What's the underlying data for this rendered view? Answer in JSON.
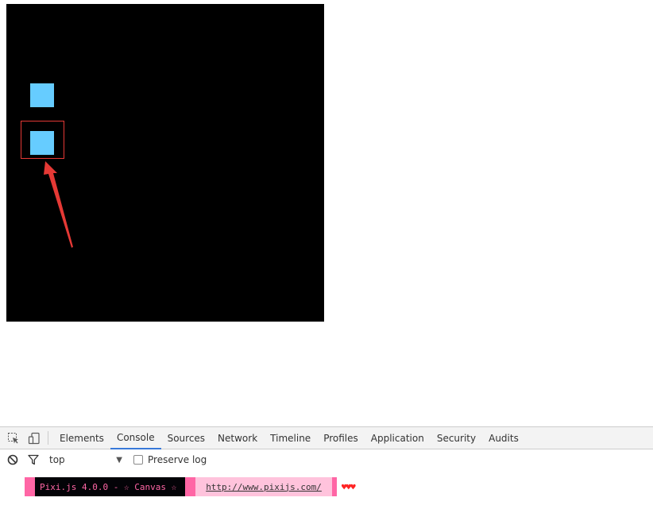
{
  "canvas": {
    "background": "#000000",
    "sprite_color": "#66ccff",
    "annotation_color": "#e53935"
  },
  "devtools": {
    "tools": [
      {
        "icon": "inspect-element-icon"
      },
      {
        "icon": "device-toolbar-icon"
      }
    ],
    "tabs": [
      {
        "label": "Elements",
        "active": false
      },
      {
        "label": "Console",
        "active": true
      },
      {
        "label": "Sources",
        "active": false
      },
      {
        "label": "Network",
        "active": false
      },
      {
        "label": "Timeline",
        "active": false
      },
      {
        "label": "Profiles",
        "active": false
      },
      {
        "label": "Application",
        "active": false
      },
      {
        "label": "Security",
        "active": false
      },
      {
        "label": "Audits",
        "active": false
      }
    ],
    "toolbar": {
      "clear_icon": "clear-console-icon",
      "filter_icon": "filter-icon",
      "context": "top",
      "context_arrow": "▼",
      "preserve_log_label": "Preserve log",
      "preserve_log_checked": false
    },
    "console": {
      "log_badge": "Pixi.js 4.0.0 - ☆ Canvas ☆",
      "log_link": "http://www.pixijs.com/",
      "log_hearts": "♥♥♥",
      "accent_pink": "#ff66a5",
      "light_pink": "#ffc3dc"
    }
  }
}
